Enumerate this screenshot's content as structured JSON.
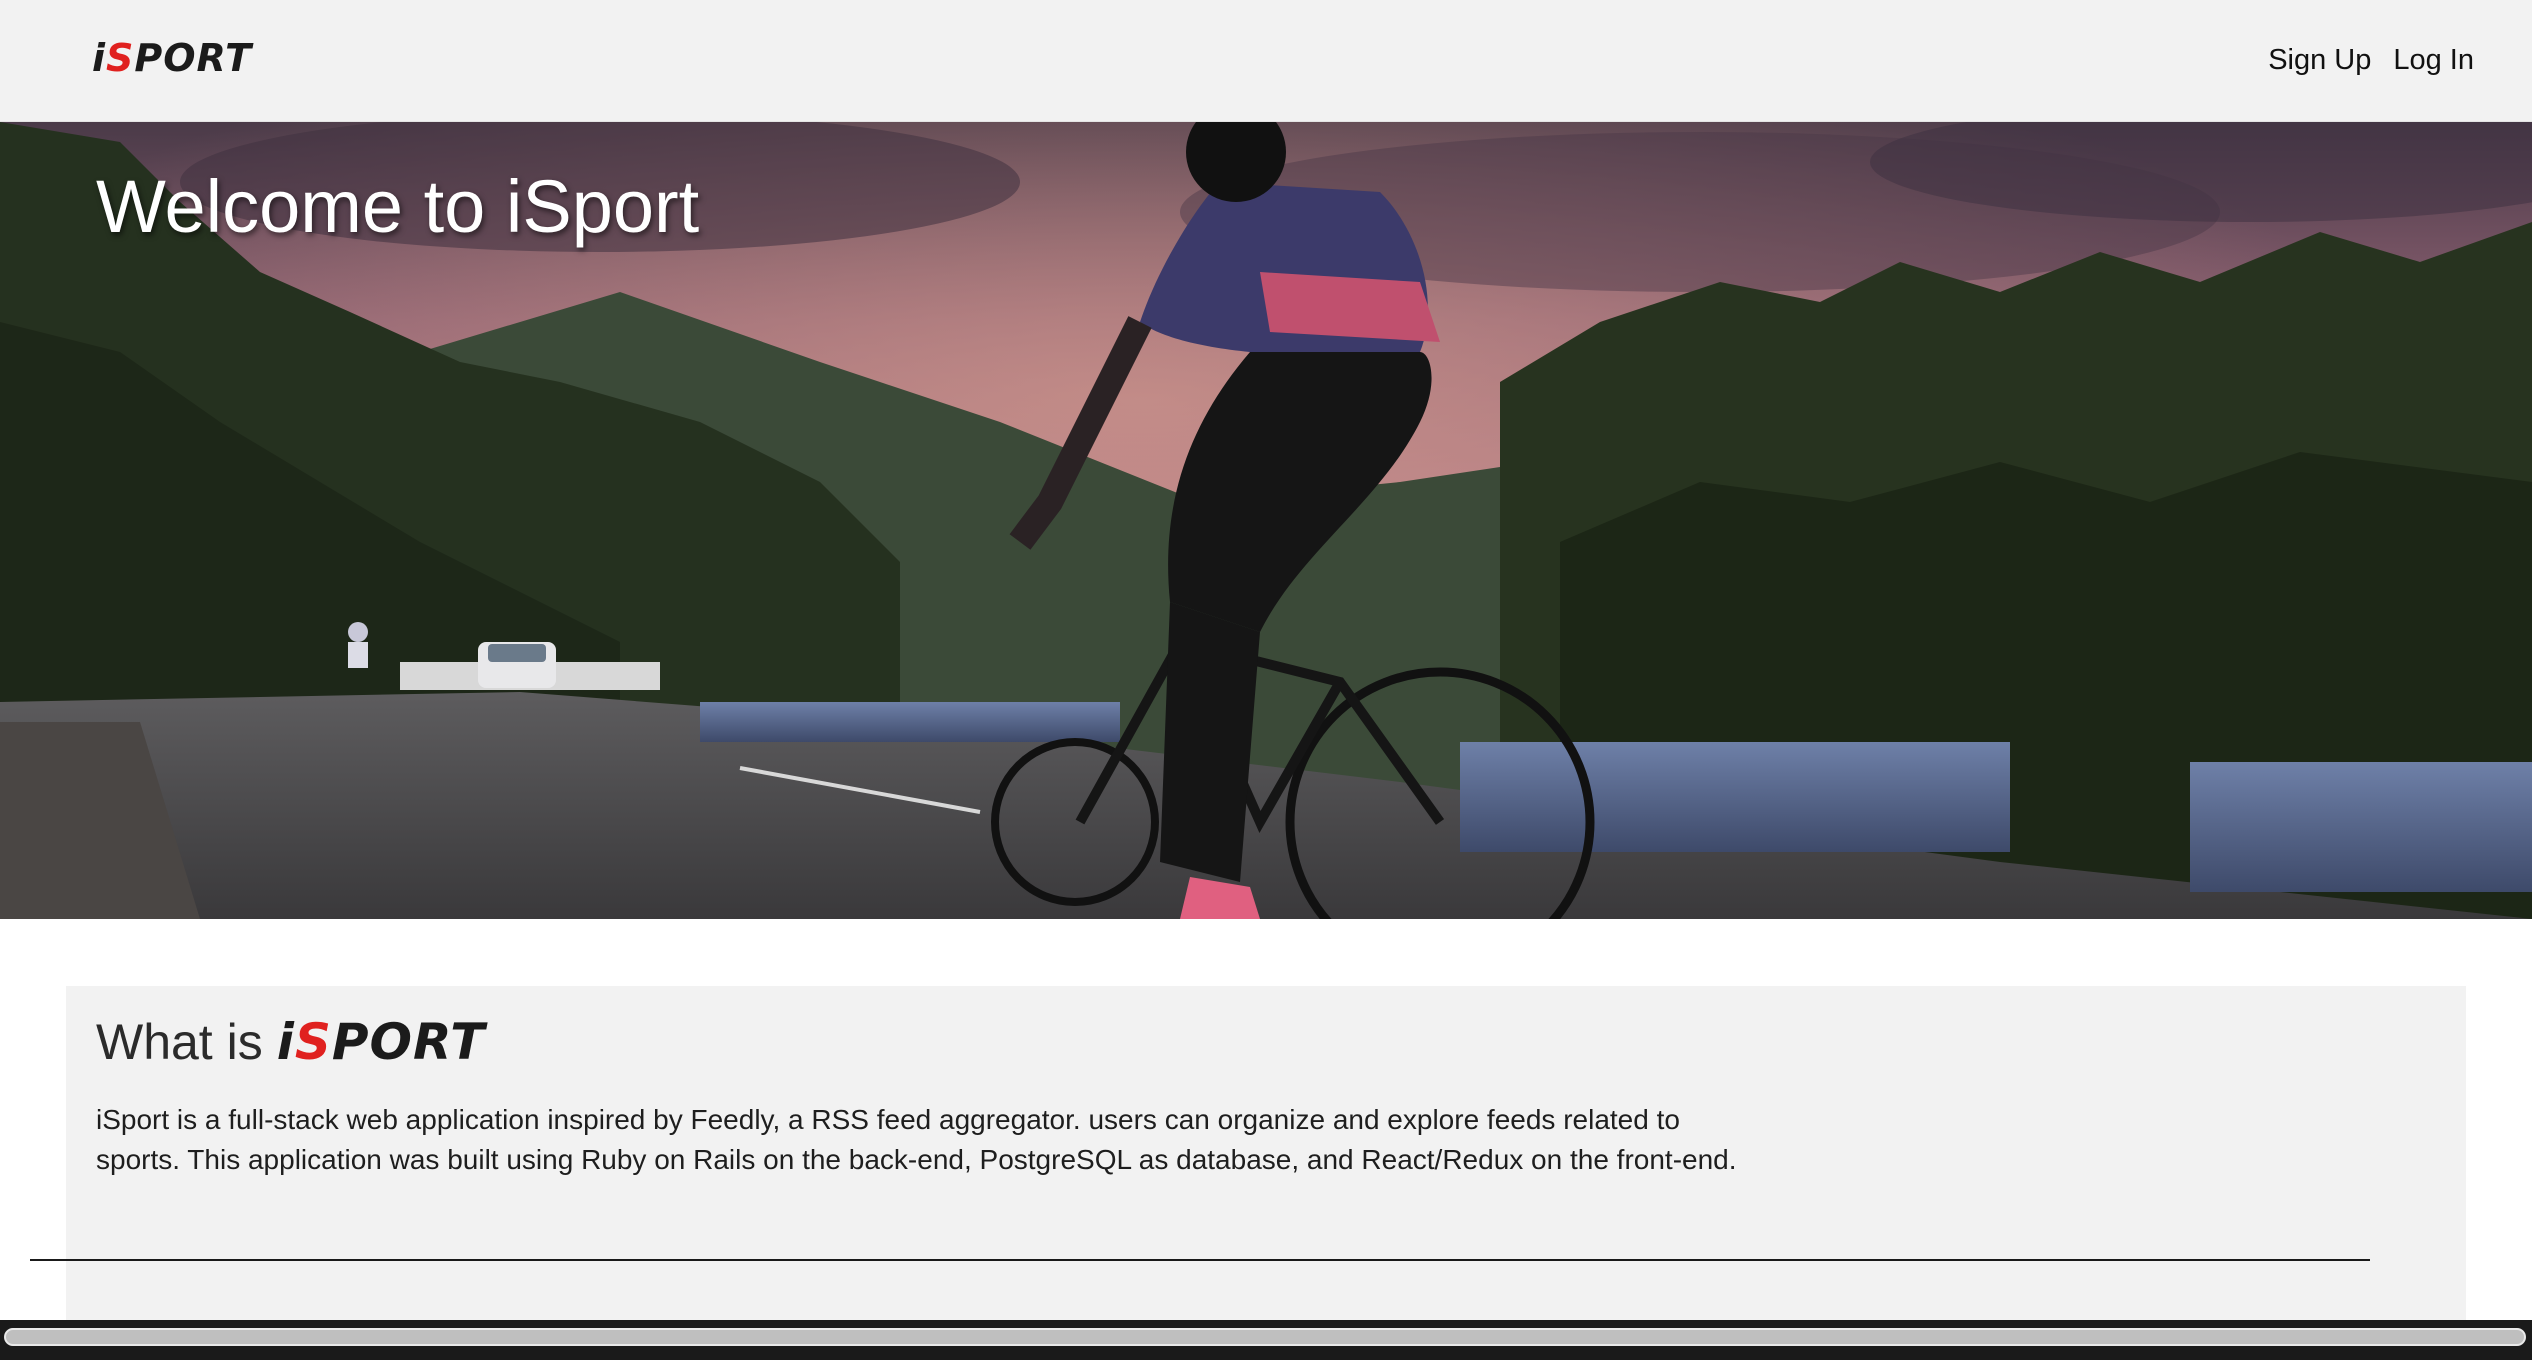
{
  "header": {
    "logo": {
      "i": "i",
      "s": "S",
      "rest": "PORT"
    },
    "nav": {
      "signup_label": "Sign Up",
      "login_label": "Log In"
    }
  },
  "hero": {
    "title": "Welcome to iSport"
  },
  "about": {
    "heading_prefix": "What is",
    "brand": {
      "i": "i",
      "s": "S",
      "rest": "PORT"
    },
    "description": "iSport is a full-stack web application inspired by Feedly, a RSS feed aggregator. users can organize and explore feeds related to sports. This application was built using Ruby on Rails on the back-end, PostgreSQL as database, and React/Redux on the front-end."
  },
  "colors": {
    "brand_red": "#e0211f",
    "brand_dark": "#1b1b1b",
    "header_bg": "#f2f2f2"
  }
}
